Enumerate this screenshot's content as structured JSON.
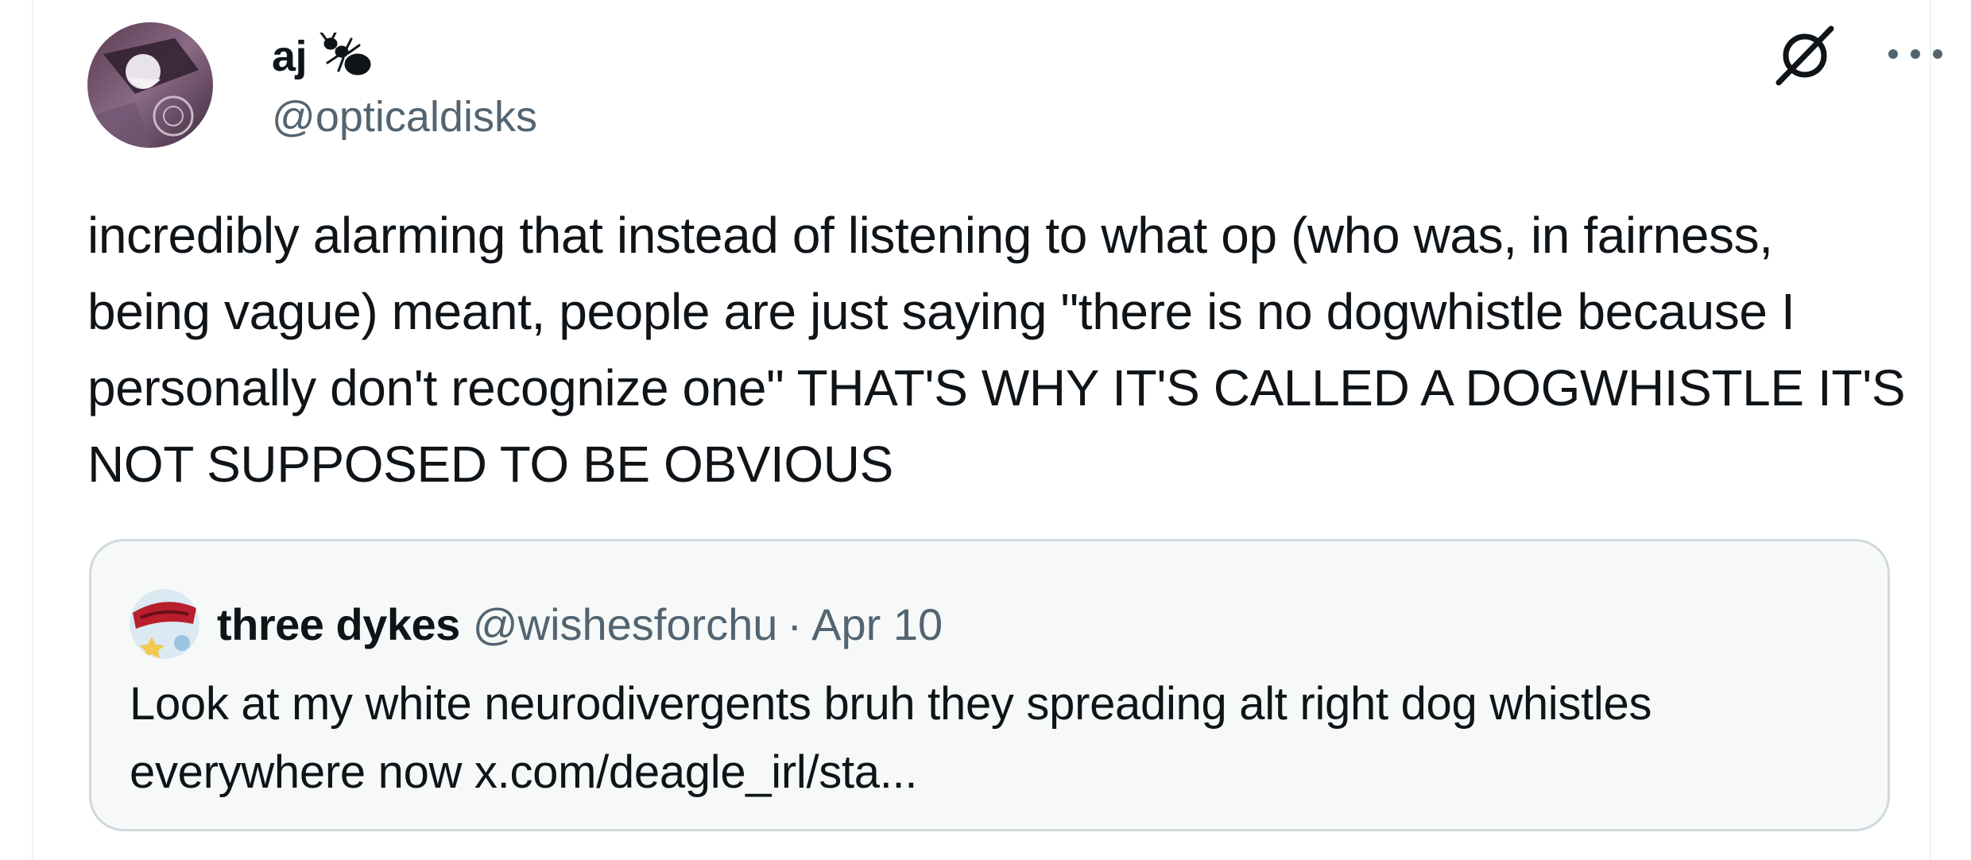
{
  "author": {
    "display_name": "aj",
    "handle": "@opticaldisks",
    "badge_icon": "ant-icon"
  },
  "header_actions": {
    "status_icon": "no-entry-icon",
    "more_icon": "more-icon"
  },
  "tweet": {
    "text": "incredibly alarming that instead of listening to what op (who was, in fairness, being vague) meant, people are just saying \"there is no dogwhistle because I personally don't recognize one\" THAT'S WHY IT'S CALLED A DOGWHISTLE IT'S NOT SUPPOSED TO BE OBVIOUS"
  },
  "quoted_tweet": {
    "display_name": "three dykes",
    "handle": "@wishesforchu",
    "separator": "·",
    "date": "Apr 10",
    "text": "Look at my white neurodivergents bruh they spreading alt right dog whistles everywhere now x.com/deagle_irl/sta..."
  },
  "colors": {
    "text_primary": "#0f1419",
    "text_secondary": "#536471",
    "quote_border": "#cfd9de",
    "quote_background": "#f7f9f9"
  }
}
